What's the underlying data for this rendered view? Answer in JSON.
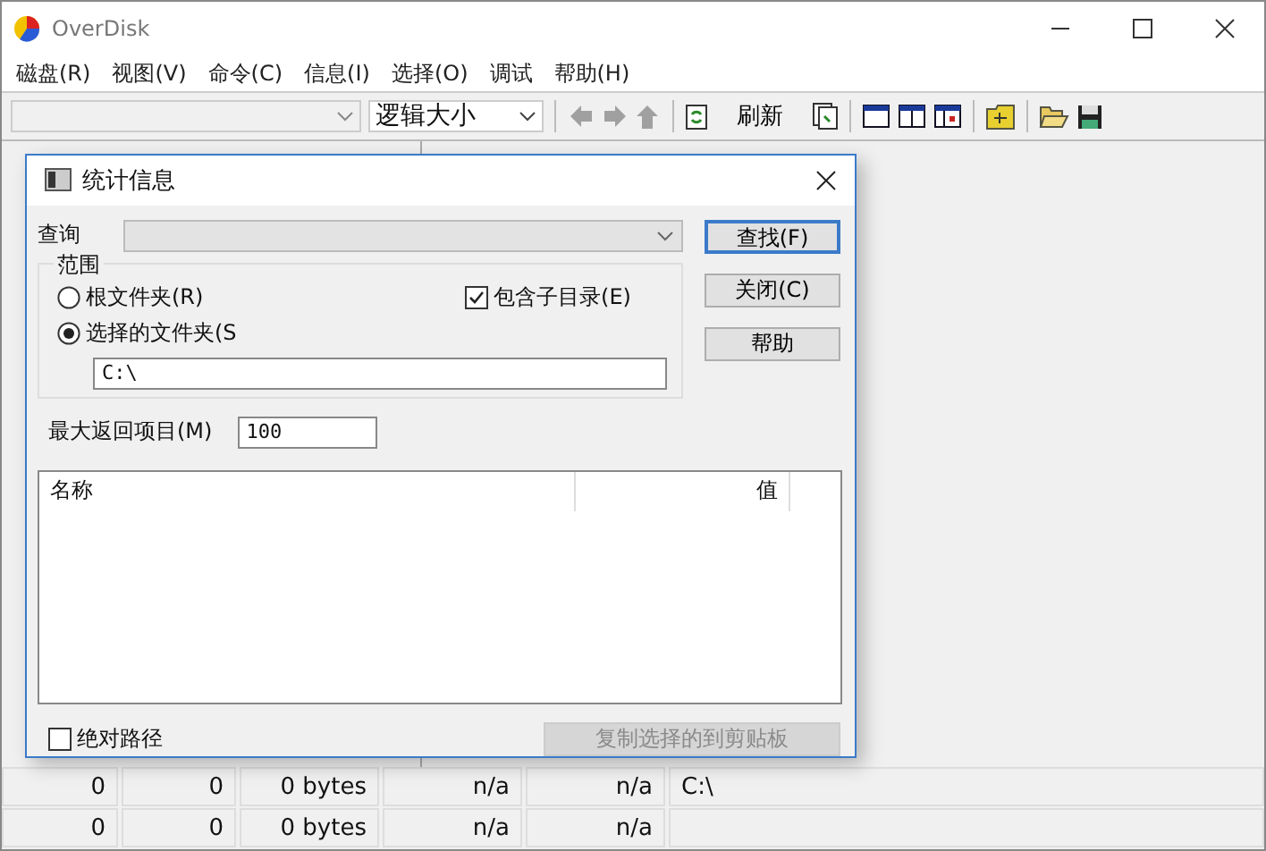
{
  "window": {
    "title": "OverDisk"
  },
  "menu": [
    {
      "label": "磁盘(R)"
    },
    {
      "label": "视图(V)"
    },
    {
      "label": "命令(C)"
    },
    {
      "label": "信息(I)"
    },
    {
      "label": "选择(O)"
    },
    {
      "label": "调试"
    },
    {
      "label": "帮助(H)"
    }
  ],
  "toolbar": {
    "size_combo": {
      "value": "逻辑大小"
    },
    "nav": [
      {
        "kind": "back",
        "disabled": true
      },
      {
        "kind": "forward",
        "disabled": true
      },
      {
        "kind": "up",
        "disabled": true
      }
    ],
    "refresh_label": "刷新"
  },
  "dialog": {
    "title": "统计信息",
    "query": {
      "label": "查询",
      "disabled": true
    },
    "buttons": [
      {
        "label": "查找(F)",
        "default": true
      },
      {
        "label": "关闭(C)",
        "default": false
      },
      {
        "label": "帮助",
        "default": false
      }
    ],
    "scope": {
      "title": "范围",
      "options": [
        {
          "label": "根文件夹(R)",
          "selected": false
        },
        {
          "label": "选择的文件夹(S",
          "selected": true
        }
      ],
      "include_subdirs": {
        "label": "包含子目录(E)",
        "checked": true
      },
      "folder": "C:\\"
    },
    "max_items": {
      "label": "最大返回项目(M)",
      "value": "100"
    },
    "columns": [
      "名称",
      "值"
    ],
    "absolute_path": {
      "label": "绝对路径",
      "checked": false
    },
    "copy_button": {
      "label": "复制选择的到剪贴板",
      "disabled": true
    }
  },
  "status_rows": [
    [
      "0",
      "0",
      "0 bytes",
      "n/a",
      "n/a",
      "C:\\"
    ],
    [
      "0",
      "0",
      "0 bytes",
      "n/a",
      "n/a",
      ""
    ]
  ]
}
